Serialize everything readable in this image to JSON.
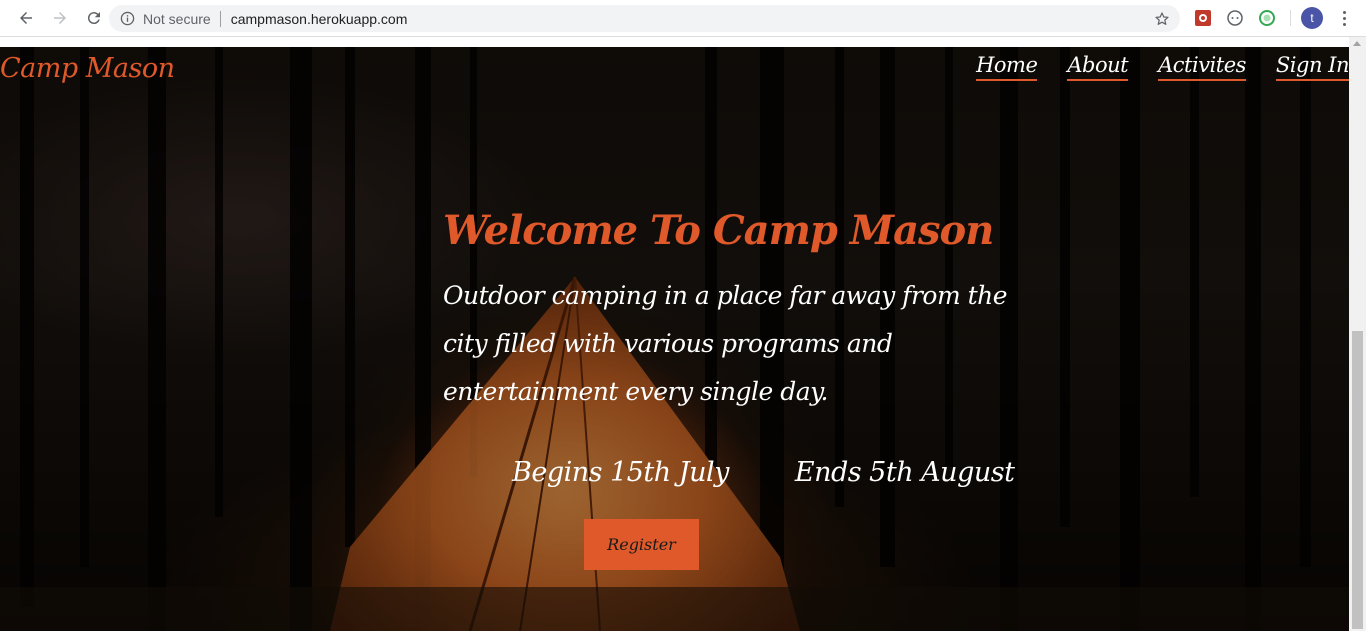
{
  "browser": {
    "security_label": "Not secure",
    "url": "campmason.herokuapp.com",
    "profile_initial": "t",
    "icons": [
      "back-arrow-icon",
      "forward-arrow-icon",
      "reload-icon",
      "info-icon",
      "star-icon",
      "extension-icon",
      "extension-icon",
      "extension-icon",
      "menu-dots-icon"
    ]
  },
  "site": {
    "brand": "Camp Mason",
    "nav": [
      {
        "label": "Home"
      },
      {
        "label": "About"
      },
      {
        "label": "Activites"
      },
      {
        "label": "Sign In"
      }
    ],
    "hero": {
      "title": "Welcome To Camp Mason",
      "description": "Outdoor camping in a place far away from the city filled with various programs and entertainment every single day.",
      "begins": "Begins 15th July",
      "ends": "Ends 5th August",
      "register_label": "Register"
    }
  },
  "colors": {
    "accent": "#e0592a",
    "text_light": "#ffffff"
  }
}
